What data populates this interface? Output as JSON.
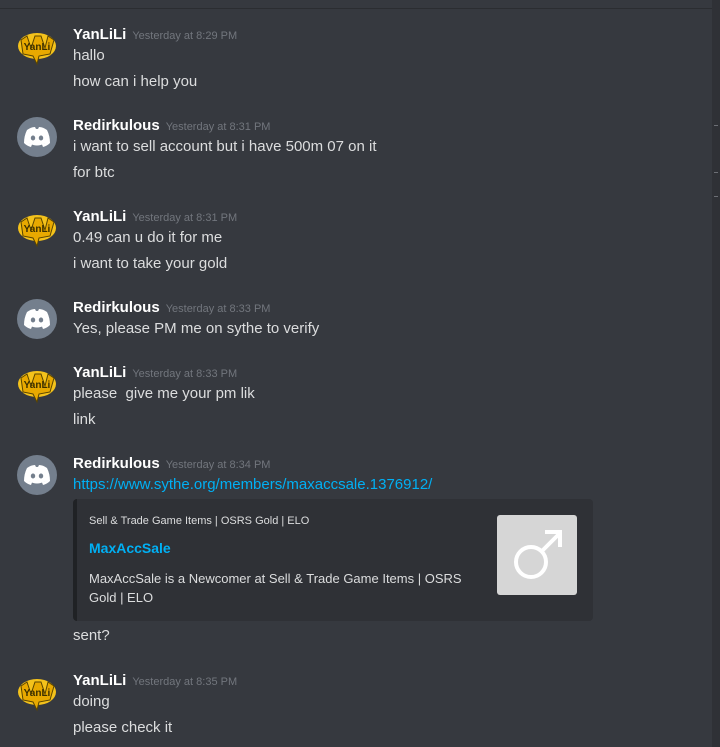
{
  "colors": {
    "background": "#36393f",
    "username": "#ffffff",
    "timestamp": "#72767d",
    "text": "#dcddde",
    "link": "#00b0f4",
    "embed_bg": "#2f3136"
  },
  "messages": [
    {
      "user": "YanLiLi",
      "avatar": "yanlili-avatar-icon",
      "timestamp": "Yesterday at 8:29 PM",
      "lines": [
        "hallo",
        "how can i help you"
      ]
    },
    {
      "user": "Redirkulous",
      "avatar": "discord-avatar-icon",
      "timestamp": "Yesterday at 8:31 PM",
      "lines": [
        "i want to sell account but i have 500m 07 on it",
        "for btc"
      ]
    },
    {
      "user": "YanLiLi",
      "avatar": "yanlili-avatar-icon",
      "timestamp": "Yesterday at 8:31 PM",
      "lines": [
        "0.49 can u do it for me",
        "i want to take your gold"
      ]
    },
    {
      "user": "Redirkulous",
      "avatar": "discord-avatar-icon",
      "timestamp": "Yesterday at 8:33 PM",
      "lines": [
        "Yes, please PM me on sythe to verify"
      ]
    },
    {
      "user": "YanLiLi",
      "avatar": "yanlili-avatar-icon",
      "timestamp": "Yesterday at 8:33 PM",
      "lines": [
        "please  give me your pm lik",
        "link"
      ]
    },
    {
      "user": "Redirkulous",
      "avatar": "discord-avatar-icon",
      "timestamp": "Yesterday at 8:34 PM",
      "link": "https://www.sythe.org/members/maxaccsale.1376912/",
      "embed": {
        "provider": "Sell & Trade Game Items | OSRS Gold | ELO",
        "title": "MaxAccSale",
        "description": "MaxAccSale is a Newcomer at Sell & Trade Game Items | OSRS Gold | ELO",
        "thumbnail": "male-symbol-icon"
      },
      "after_line": "sent?"
    },
    {
      "user": "YanLiLi",
      "avatar": "yanlili-avatar-icon",
      "timestamp": "Yesterday at 8:35 PM",
      "lines": [
        "doing",
        "please check it"
      ]
    }
  ]
}
